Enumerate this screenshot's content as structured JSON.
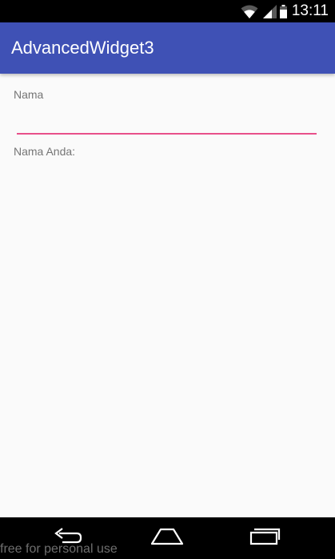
{
  "status_bar": {
    "time": "13:11",
    "icons": [
      "wifi-icon",
      "signal-icon",
      "battery-icon"
    ]
  },
  "app_bar": {
    "title": "AdvancedWidget3",
    "color": "#3f51b5"
  },
  "form": {
    "name_label": "Nama",
    "name_input_value": "",
    "name_input_placeholder": "",
    "output_label": "Nama Anda:",
    "accent_color": "#e8508a"
  },
  "nav_bar": {
    "icons": [
      "back-icon",
      "home-icon",
      "recents-icon"
    ]
  },
  "watermark": {
    "text": "free for personal use"
  }
}
